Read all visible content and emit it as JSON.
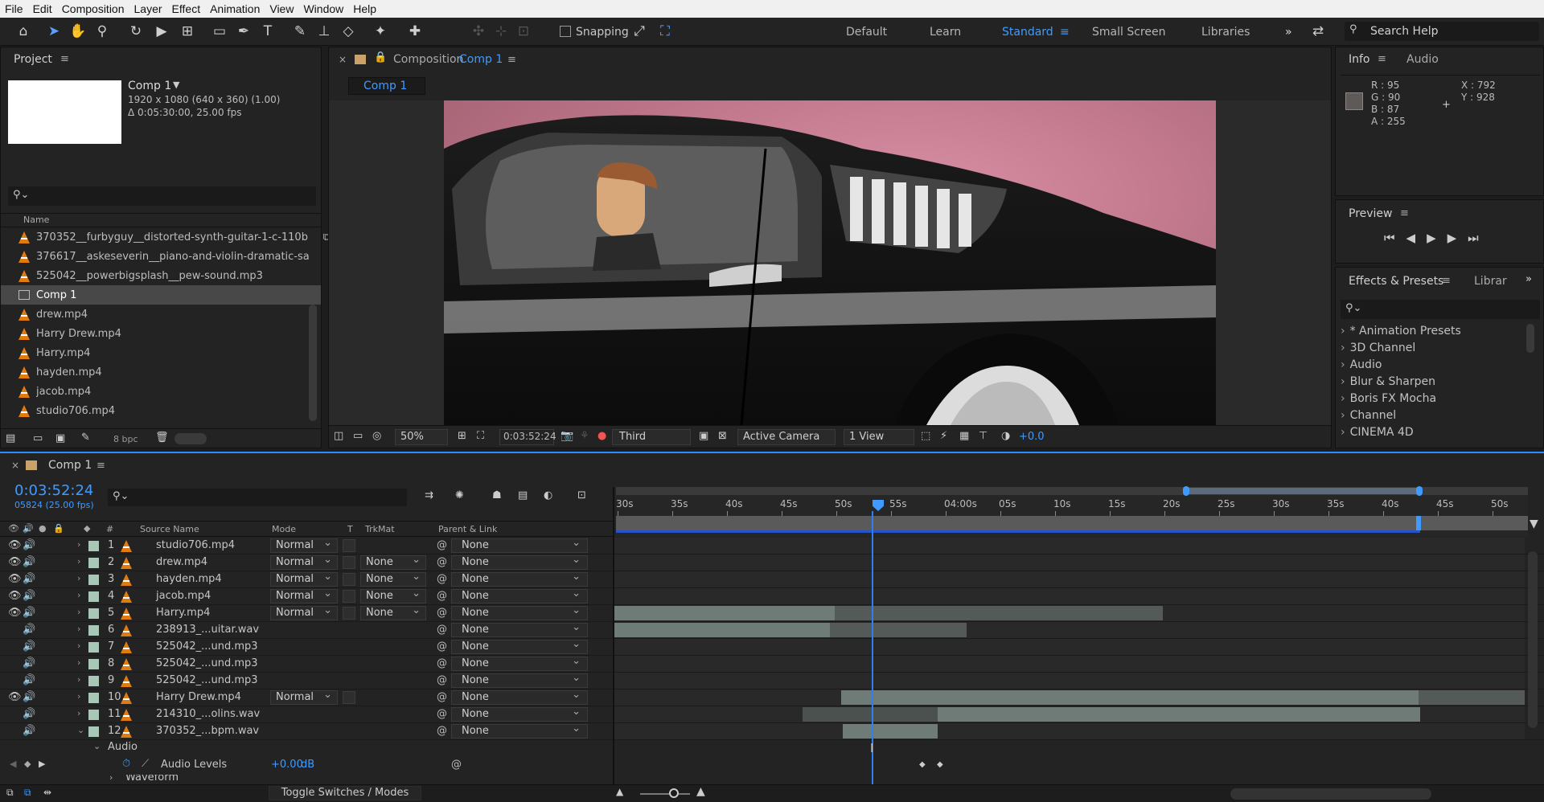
{
  "menu": [
    "File",
    "Edit",
    "Composition",
    "Layer",
    "Effect",
    "Animation",
    "View",
    "Window",
    "Help"
  ],
  "toolbar": {
    "snapping": "Snapping",
    "search": "Search Help",
    "workspaces": [
      "Default",
      "Learn",
      "Standard",
      "Small Screen",
      "Libraries"
    ]
  },
  "project": {
    "title": "Project",
    "comp_name": "Comp 1",
    "comp_size": "1920 x 1080  (640 x 360) (1.00)",
    "comp_dur": "Δ 0:05:30:00, 25.00 fps",
    "col_name": "Name",
    "bpc": "8 bpc",
    "items": [
      {
        "name": "370352__furbyguy__distorted-synth-guitar-1-c-110b",
        "icon": "audio"
      },
      {
        "name": "376617__askeseverin__piano-and-violin-dramatic-sa",
        "icon": "audio"
      },
      {
        "name": "525042__powerbigsplash__pew-sound.mp3",
        "icon": "audio"
      },
      {
        "name": "Comp 1",
        "icon": "comp",
        "selected": true
      },
      {
        "name": "drew.mp4",
        "icon": "video"
      },
      {
        "name": "Harry Drew.mp4",
        "icon": "video"
      },
      {
        "name": "Harry.mp4",
        "icon": "video"
      },
      {
        "name": "hayden.mp4",
        "icon": "video"
      },
      {
        "name": "jacob.mp4",
        "icon": "video"
      },
      {
        "name": "studio706.mp4",
        "icon": "video"
      }
    ]
  },
  "viewer": {
    "tab_prefix": "Composition",
    "tab_comp": "Comp 1",
    "sub_tab": "Comp 1",
    "zoom": "50%",
    "time": "0:03:52:24",
    "resolution": "Third",
    "camera": "Active Camera",
    "views": "1 View",
    "exposure": "+0.0"
  },
  "info": {
    "title": "Info",
    "tab_audio": "Audio",
    "r": "R : 95",
    "g": "G : 90",
    "b": "B : 87",
    "a": "A :  255",
    "x": "X : 792",
    "y": "Y : 928",
    "swatch": "#5f5a57"
  },
  "preview": {
    "title": "Preview"
  },
  "effects": {
    "title": "Effects & Presets",
    "tab2": "Librar",
    "items": [
      "* Animation Presets",
      "3D Channel",
      "Audio",
      "Blur & Sharpen",
      "Boris FX Mocha",
      "Channel",
      "CINEMA 4D"
    ]
  },
  "timeline": {
    "comp": "Comp 1",
    "timecode": "0:03:52:24",
    "frames": "05824 (25.00 fps)",
    "cols": {
      "num": "#",
      "source": "Source Name",
      "mode": "Mode",
      "t": "T",
      "trkmat": "TrkMat",
      "parent": "Parent & Link"
    },
    "ruler": [
      "30s",
      "35s",
      "40s",
      "45s",
      "50s",
      "55s",
      "04:00s",
      "05s",
      "10s",
      "15s",
      "20s",
      "25s",
      "30s",
      "35s",
      "40s",
      "45s",
      "50s"
    ],
    "layers": [
      {
        "n": "1",
        "name": "studio706.mp4",
        "mode": "Normal",
        "trk": "",
        "parent": "None",
        "video": true
      },
      {
        "n": "2",
        "name": "drew.mp4",
        "mode": "Normal",
        "trk": "None",
        "parent": "None",
        "video": true
      },
      {
        "n": "3",
        "name": "hayden.mp4",
        "mode": "Normal",
        "trk": "None",
        "parent": "None",
        "video": true
      },
      {
        "n": "4",
        "name": "jacob.mp4",
        "mode": "Normal",
        "trk": "None",
        "parent": "None",
        "video": true
      },
      {
        "n": "5",
        "name": "Harry.mp4",
        "mode": "Normal",
        "trk": "None",
        "parent": "None",
        "video": true
      },
      {
        "n": "6",
        "name": "238913_...uitar.wav",
        "mode": "",
        "trk": "",
        "parent": "None",
        "video": false
      },
      {
        "n": "7",
        "name": "525042_...und.mp3",
        "mode": "",
        "trk": "",
        "parent": "None",
        "video": false
      },
      {
        "n": "8",
        "name": "525042_...und.mp3",
        "mode": "",
        "trk": "",
        "parent": "None",
        "video": false
      },
      {
        "n": "9",
        "name": "525042_...und.mp3",
        "mode": "",
        "trk": "",
        "parent": "None",
        "video": false
      },
      {
        "n": "10",
        "name": "Harry Drew.mp4",
        "mode": "Normal",
        "trk": "",
        "parent": "None",
        "video": true
      },
      {
        "n": "11",
        "name": "214310_...olins.wav",
        "mode": "",
        "trk": "",
        "parent": "None",
        "video": false
      },
      {
        "n": "12",
        "name": "370352_...bpm.wav",
        "mode": "",
        "trk": "",
        "parent": "None",
        "video": false
      }
    ],
    "audio_group": "Audio",
    "audio_levels": "Audio Levels",
    "audio_value": "+0.00",
    "audio_unit": "dB",
    "waveform": "Waveform",
    "toggle": "Toggle Switches / Modes"
  }
}
